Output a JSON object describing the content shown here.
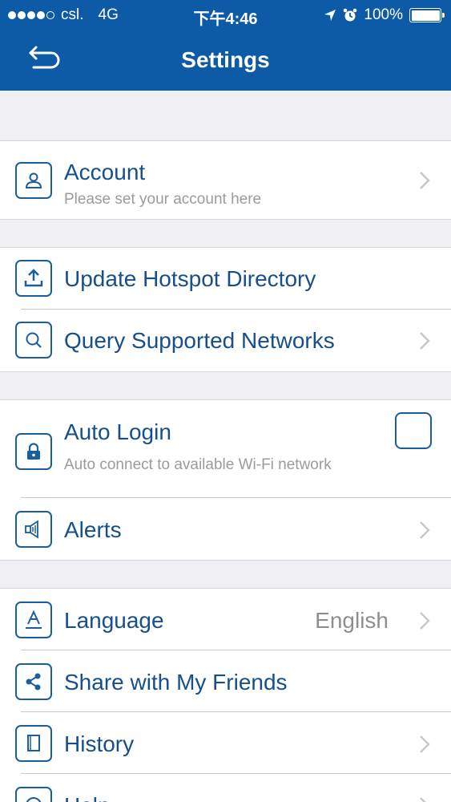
{
  "status_bar": {
    "carrier": "csl.",
    "network": "4G",
    "time": "下午4:46",
    "battery": "100%",
    "battery_level": 1.0,
    "signal_dots": 4
  },
  "nav": {
    "title": "Settings"
  },
  "groups": [
    {
      "items": [
        {
          "title": "Account",
          "subtitle": "Please set your account here",
          "icon": "user-icon",
          "chevron": true
        }
      ]
    },
    {
      "items": [
        {
          "title": "Update Hotspot Directory",
          "icon": "upload-icon",
          "chevron": false
        },
        {
          "title": "Query Supported Networks",
          "icon": "search-icon",
          "chevron": true
        }
      ]
    },
    {
      "items": [
        {
          "title": "Auto Login",
          "subtitle": "Auto connect to available Wi-Fi network",
          "icon": "lock-icon",
          "checkbox": true,
          "checked": false
        },
        {
          "title": "Alerts",
          "icon": "speaker-icon",
          "chevron": true
        }
      ]
    },
    {
      "items": [
        {
          "title": "Language",
          "value": "English",
          "icon": "language-icon",
          "chevron": true
        },
        {
          "title": "Share with My Friends",
          "icon": "share-icon",
          "chevron": false
        },
        {
          "title": "History",
          "icon": "book-icon",
          "chevron": true
        },
        {
          "title": "Help",
          "icon": "help-icon",
          "chevron": true
        }
      ]
    }
  ],
  "colors": {
    "header": "#0d5aa7",
    "accent": "#1a5e9e",
    "title_text": "#164f8c",
    "background": "#efeff4"
  }
}
